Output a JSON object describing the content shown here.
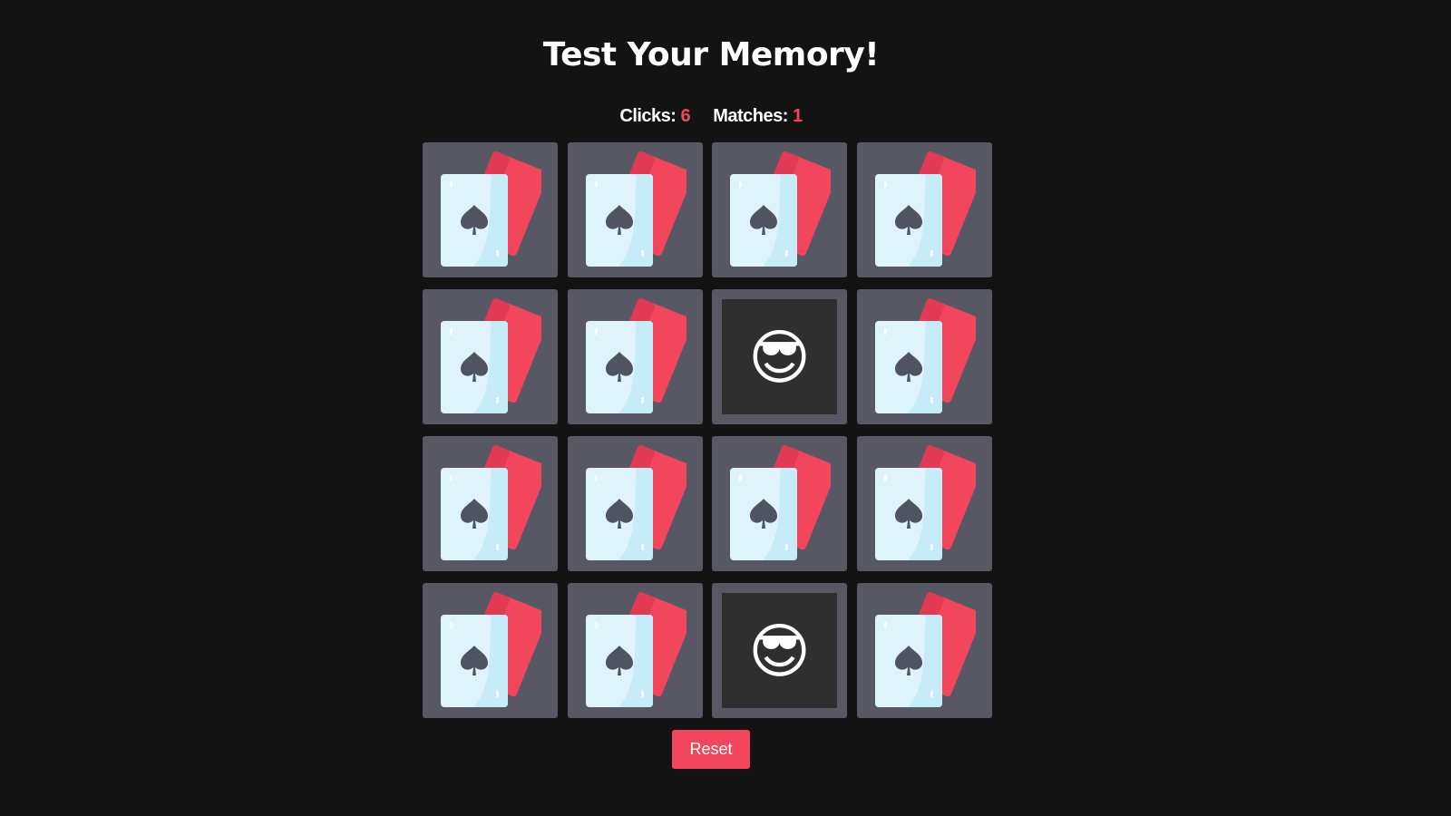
{
  "game": {
    "title": "Test Your Memory!",
    "clicks_label": "Clicks:",
    "clicks_value": "6",
    "matches_label": "Matches:",
    "matches_value": "1",
    "reset_label": "Reset"
  },
  "board": {
    "columns": 4,
    "rows": 4,
    "cards": [
      {
        "state": "hidden"
      },
      {
        "state": "hidden"
      },
      {
        "state": "hidden"
      },
      {
        "state": "hidden"
      },
      {
        "state": "hidden"
      },
      {
        "state": "hidden"
      },
      {
        "state": "revealed",
        "face": "😎"
      },
      {
        "state": "hidden"
      },
      {
        "state": "hidden"
      },
      {
        "state": "hidden"
      },
      {
        "state": "hidden"
      },
      {
        "state": "hidden"
      },
      {
        "state": "hidden"
      },
      {
        "state": "hidden"
      },
      {
        "state": "revealed",
        "face": "😎"
      },
      {
        "state": "hidden"
      }
    ]
  },
  "icons": {
    "card_back": "playing-cards-icon",
    "face": "smiling-face-with-sunglasses-icon"
  },
  "colors": {
    "background": "#131313",
    "accent": "#f2465d",
    "card_tile": "#575864",
    "revealed_face": "#2f2f2f",
    "card_front": "#dff3fb",
    "spade": "#505362"
  }
}
